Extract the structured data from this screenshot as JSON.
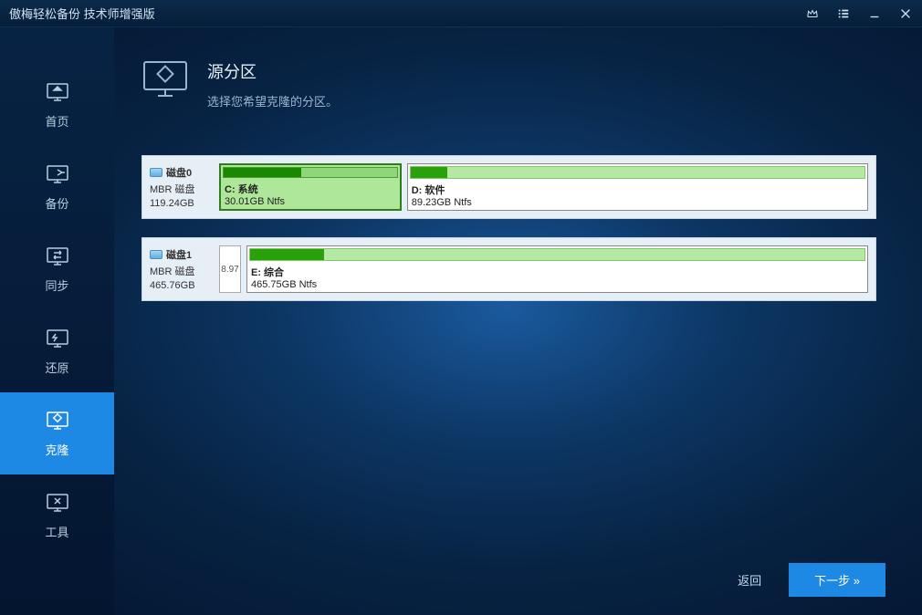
{
  "titlebar": {
    "title": "傲梅轻松备份 技术师增强版"
  },
  "sidebar": {
    "items": [
      {
        "label": "首页"
      },
      {
        "label": "备份"
      },
      {
        "label": "同步"
      },
      {
        "label": "还原"
      },
      {
        "label": "克隆"
      },
      {
        "label": "工具"
      }
    ]
  },
  "header": {
    "title": "源分区",
    "subtitle": "选择您希望克隆的分区。"
  },
  "disks": [
    {
      "name": "磁盘0",
      "type": "MBR 磁盘",
      "size": "119.24GB",
      "partitions": [
        {
          "label": "C: 系统",
          "detail": "30.01GB Ntfs",
          "selected": true,
          "flex": 0.28,
          "used_pct": 45
        },
        {
          "label": "D: 软件",
          "detail": "89.23GB Ntfs",
          "selected": false,
          "flex": 0.72,
          "used_pct": 8
        }
      ]
    },
    {
      "name": "磁盘1",
      "type": "MBR 磁盘",
      "size": "465.76GB",
      "small_partition": "8.97",
      "partitions": [
        {
          "label": "E: 综合",
          "detail": "465.75GB Ntfs",
          "selected": false,
          "flex": 1,
          "used_pct": 12
        }
      ]
    }
  ],
  "footer": {
    "back": "返回",
    "next": "下一步 »"
  }
}
